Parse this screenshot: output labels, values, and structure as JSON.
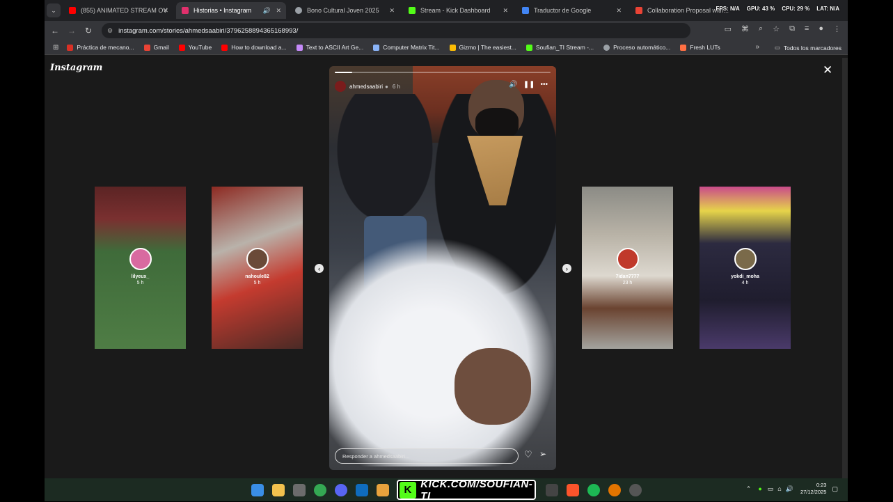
{
  "browser": {
    "tabs": [
      {
        "label": "(855) ANIMATED STREAM OVE",
        "active": false,
        "icon": "youtube-icon",
        "color": "#ff0000"
      },
      {
        "label": "Historias • Instagram",
        "active": true,
        "icon": "instagram-icon",
        "color": "#e1306c"
      },
      {
        "label": "Bono Cultural Joven 2025",
        "active": false,
        "icon": "globe-icon",
        "color": "#9aa0a6"
      },
      {
        "label": "Stream - Kick Dashboard",
        "active": false,
        "icon": "kick-icon",
        "color": "#53fc18"
      },
      {
        "label": "Traductor de Google",
        "active": false,
        "icon": "translate-icon",
        "color": "#4285f4"
      },
      {
        "label": "Collaboration Proposal with...",
        "active": false,
        "icon": "gmail-icon",
        "color": "#ea4335"
      }
    ],
    "stats": [
      "FPS: N/A",
      "GPU: 43 %",
      "CPU: 29 %",
      "LAT: N/A"
    ],
    "url": "instagram.com/stories/ahmedsaabiri/3796258894365168993/",
    "bookmarks": [
      {
        "label": "Práctica de mecano...",
        "color": "#d93025"
      },
      {
        "label": "Gmail",
        "color": "#ea4335"
      },
      {
        "label": "YouTube",
        "color": "#ff0000"
      },
      {
        "label": "How to download a...",
        "color": "#ff0000"
      },
      {
        "label": "Text to ASCII Art Ge...",
        "color": "#c58af9"
      },
      {
        "label": "Computer Matrix Tit...",
        "color": "#8ab4f8"
      },
      {
        "label": "Gizmo | The easiest...",
        "color": "#fbbc04"
      },
      {
        "label": "Soufian_TI Stream -...",
        "color": "#53fc18"
      },
      {
        "label": "Proceso automático...",
        "color": "#9aa0a6"
      },
      {
        "label": "Fresh LUTs",
        "color": "#ff7043"
      }
    ],
    "all_bookmarks": "Todos los marcadores"
  },
  "instagram": {
    "logo": "Instagram",
    "story": {
      "username": "ahmedsaabiri",
      "time": "6 h",
      "reply_placeholder": "Responder a ahmedsaabiri..."
    },
    "side_stories": [
      {
        "name": "lilyeux_",
        "time": "5 h",
        "bg": "#3f6b3a"
      },
      {
        "name": "nahoule82",
        "time": "5 h",
        "bg": "#a53a2e"
      },
      {
        "name": "7idan7777",
        "time": "23 h",
        "bg": "#9a9a94"
      },
      {
        "name": "yokdi_moha",
        "time": "4 h",
        "bg": "#3b2a55"
      }
    ]
  },
  "taskbar": {
    "kick_label": "KICK.COM/SOUFIAN-TI",
    "time": "0:23",
    "date": "27/12/2025"
  }
}
